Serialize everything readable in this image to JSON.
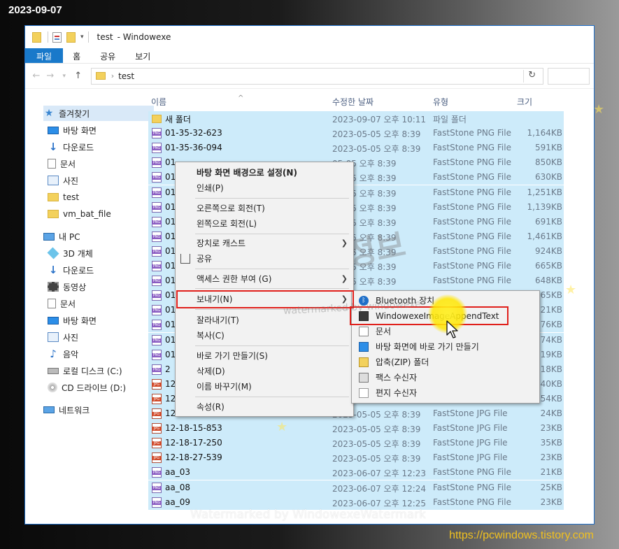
{
  "date_stamp": "2023-09-07",
  "site_url": "https://pcwindows.tistory.com",
  "window": {
    "title_folder": "test",
    "title_app": "- Windowexe"
  },
  "ribbon": {
    "tabs": [
      "파일",
      "홈",
      "공유",
      "보기"
    ]
  },
  "address": {
    "path": "test"
  },
  "nav": {
    "items": [
      {
        "label": "즐겨찾기",
        "icon": "star-icon"
      },
      {
        "label": "바탕 화면",
        "icon": "desktop-icon"
      },
      {
        "label": "다운로드",
        "icon": "download-icon"
      },
      {
        "label": "문서",
        "icon": "document-icon"
      },
      {
        "label": "사진",
        "icon": "pictures-icon"
      },
      {
        "label": "test",
        "icon": "folder-icon"
      },
      {
        "label": "vm_bat_file",
        "icon": "folder-icon"
      },
      {
        "label": "내 PC",
        "icon": "pc-icon"
      },
      {
        "label": "3D 개체",
        "icon": "3d-objects-icon"
      },
      {
        "label": "다운로드",
        "icon": "download-icon"
      },
      {
        "label": "동영상",
        "icon": "video-icon"
      },
      {
        "label": "문서",
        "icon": "document-icon"
      },
      {
        "label": "바탕 화면",
        "icon": "desktop-icon"
      },
      {
        "label": "사진",
        "icon": "pictures-icon"
      },
      {
        "label": "음악",
        "icon": "music-icon"
      },
      {
        "label": "로컬 디스크 (C:)",
        "icon": "drive-icon"
      },
      {
        "label": "CD 드라이브 (D:)",
        "icon": "cd-drive-icon"
      },
      {
        "label": "네트워크",
        "icon": "network-icon"
      }
    ]
  },
  "columns": {
    "name": "이름",
    "date": "수정한 날짜",
    "type": "유형",
    "size": "크기"
  },
  "files": [
    {
      "name": "새 폴더",
      "date": "2023-09-07 오후 10:11",
      "type": "파일 폴더",
      "size": "",
      "kind": "folder"
    },
    {
      "name": "01-35-32-623",
      "date": "2023-05-05 오후 8:39",
      "type": "FastStone PNG File",
      "size": "1,164KB",
      "kind": "png"
    },
    {
      "name": "01-35-36-094",
      "date": "2023-05-05 오후 8:39",
      "type": "FastStone PNG File",
      "size": "591KB",
      "kind": "png"
    },
    {
      "name": "01",
      "date": "05-05 오후 8:39",
      "type": "FastStone PNG File",
      "size": "850KB",
      "kind": "png"
    },
    {
      "name": "01",
      "date": "05-05 오후 8:39",
      "type": "FastStone PNG File",
      "size": "630KB",
      "kind": "png"
    },
    {
      "name": "01",
      "date": "05-05 오후 8:39",
      "type": "FastStone PNG File",
      "size": "1,251KB",
      "kind": "png"
    },
    {
      "name": "01",
      "date": "05-05 오후 8:39",
      "type": "FastStone PNG File",
      "size": "1,139KB",
      "kind": "png"
    },
    {
      "name": "01",
      "date": "05-05 오후 8:39",
      "type": "FastStone PNG File",
      "size": "691KB",
      "kind": "png"
    },
    {
      "name": "01",
      "date": "05-05 오후 8:39",
      "type": "FastStone PNG File",
      "size": "1,461KB",
      "kind": "png"
    },
    {
      "name": "01",
      "date": "05-05 오후 8:39",
      "type": "FastStone PNG File",
      "size": "924KB",
      "kind": "png"
    },
    {
      "name": "01",
      "date": "05-05 오후 8:39",
      "type": "FastStone PNG File",
      "size": "665KB",
      "kind": "png"
    },
    {
      "name": "01",
      "date": "05-05 오후 8:39",
      "type": "FastStone PNG File",
      "size": "648KB",
      "kind": "png"
    },
    {
      "name": "01",
      "date": "",
      "type": "",
      "size": "765KB",
      "kind": "png"
    },
    {
      "name": "01",
      "date": "",
      "type": "",
      "size": "321KB",
      "kind": "png"
    },
    {
      "name": "01",
      "date": "",
      "type": "",
      "size": "776KB",
      "kind": "png"
    },
    {
      "name": "01",
      "date": "",
      "type": "",
      "size": "674KB",
      "kind": "png"
    },
    {
      "name": "01",
      "date": "",
      "type": "",
      "size": "319KB",
      "kind": "png"
    },
    {
      "name": "2",
      "date": "",
      "type": "",
      "size": "18KB",
      "kind": "png"
    },
    {
      "name": "12",
      "date": "",
      "type": "",
      "size": "40KB",
      "kind": "jpg"
    },
    {
      "name": "12",
      "date": "",
      "type": "",
      "size": "54KB",
      "kind": "jpg"
    },
    {
      "name": "12-18-14-304",
      "date": "2023-05-05 오후 8:39",
      "type": "FastStone JPG File",
      "size": "24KB",
      "kind": "jpg"
    },
    {
      "name": "12-18-15-853",
      "date": "2023-05-05 오후 8:39",
      "type": "FastStone JPG File",
      "size": "23KB",
      "kind": "jpg"
    },
    {
      "name": "12-18-17-250",
      "date": "2023-05-05 오후 8:39",
      "type": "FastStone JPG File",
      "size": "35KB",
      "kind": "jpg"
    },
    {
      "name": "12-18-27-539",
      "date": "2023-05-05 오후 8:39",
      "type": "FastStone JPG File",
      "size": "23KB",
      "kind": "jpg"
    },
    {
      "name": "aa_03",
      "date": "2023-06-07 오후 12:23",
      "type": "FastStone PNG File",
      "size": "21KB",
      "kind": "png"
    },
    {
      "name": "aa_08",
      "date": "2023-06-07 오후 12:24",
      "type": "FastStone PNG File",
      "size": "25KB",
      "kind": "png"
    },
    {
      "name": "aa_09",
      "date": "2023-06-07 오후 12:25",
      "type": "FastStone PNG File",
      "size": "23KB",
      "kind": "png"
    }
  ],
  "context_menu": {
    "items": [
      {
        "label": "바탕 화면 배경으로 설정(N)",
        "bold": true
      },
      {
        "label": "인쇄(P)"
      },
      {
        "label": "오른쪽으로 회전(T)"
      },
      {
        "label": "왼쪽으로 회전(L)"
      },
      {
        "label": "장치로 캐스트",
        "submenu": true
      },
      {
        "label": "공유",
        "icon": "share-icon"
      },
      {
        "label": "액세스 권한 부여 (G)",
        "submenu": true
      },
      {
        "label": "보내기(N)",
        "submenu": true
      },
      {
        "label": "잘라내기(T)"
      },
      {
        "label": "복사(C)"
      },
      {
        "label": "바로 가기 만들기(S)"
      },
      {
        "label": "삭제(D)"
      },
      {
        "label": "이름 바꾸기(M)"
      },
      {
        "label": "속성(R)"
      }
    ]
  },
  "sendto_menu": {
    "items": [
      {
        "label": "Bluetooth 장치",
        "icon": "bluetooth-icon"
      },
      {
        "label": "WindowexeImageAppendText",
        "icon": "app-icon"
      },
      {
        "label": "문서",
        "icon": "document-icon"
      },
      {
        "label": "바탕 화면에 바로 가기 만들기",
        "icon": "desktop-icon"
      },
      {
        "label": "압축(ZIP) 폴더",
        "icon": "zip-folder-icon"
      },
      {
        "label": "팩스 수신자",
        "icon": "fax-icon"
      },
      {
        "label": "편지 수신자",
        "icon": "mail-icon"
      }
    ]
  },
  "watermarks": {
    "big": "컴퓨터 관련 정보",
    "small": "watermarked by windowexe",
    "bottom": "Watermarked by WindowexeWatermark"
  },
  "colors": {
    "accent": "#1979ca",
    "row_highlight": "#cdebfa",
    "callout_red": "#e0201b",
    "url_gold": "#f0c020"
  }
}
